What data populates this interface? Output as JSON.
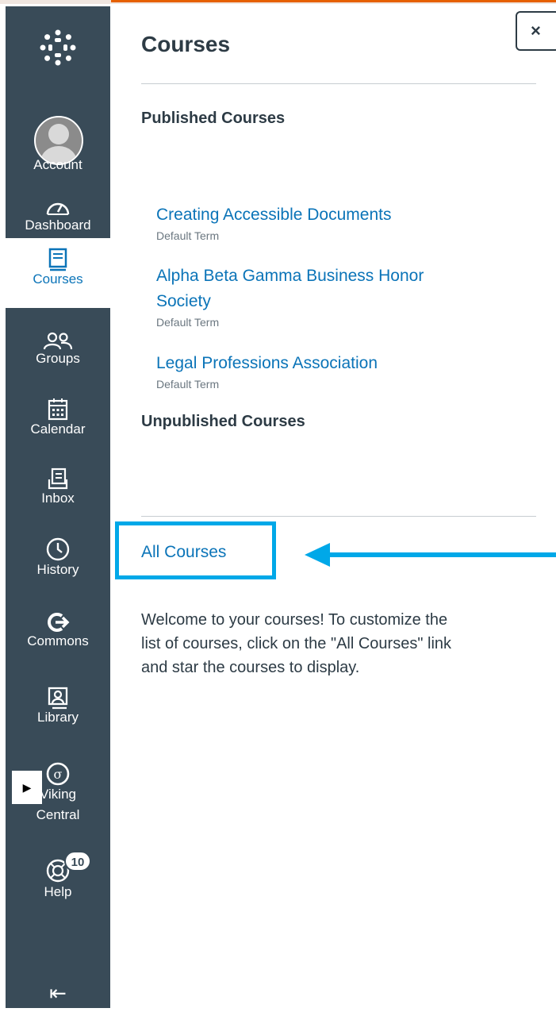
{
  "nav": {
    "account": "Account",
    "dashboard": "Dashboard",
    "courses": "Courses",
    "groups": "Groups",
    "calendar": "Calendar",
    "inbox": "Inbox",
    "history": "History",
    "commons": "Commons",
    "library": "Library",
    "viking_central_line1": "Viking",
    "viking_central_line2": "Central",
    "help": "Help",
    "help_badge": "10",
    "collapse_icon": "collapse-icon"
  },
  "tray": {
    "title": "Courses",
    "close_label": "×",
    "published_heading": "Published Courses",
    "courses": [
      {
        "name_line1": "Creating Accessible Documents",
        "term": "Default Term"
      },
      {
        "name_line1": "Alpha Beta Gamma Business Honor",
        "name_line2": "Society",
        "term": "Default Term"
      },
      {
        "name_line1": "Legal Professions Association",
        "term": "Default Term"
      }
    ],
    "unpublished_heading": "Unpublished Courses",
    "all_courses_link": "All Courses",
    "welcome_line1": "Welcome to your courses! To customize the",
    "welcome_line2": "list of courses, click on the \"All Courses\" link",
    "welcome_line3": "and star the courses to display."
  },
  "colors": {
    "nav_bg": "#394b58",
    "link": "#0b74b8",
    "highlight": "#00a8e8"
  }
}
